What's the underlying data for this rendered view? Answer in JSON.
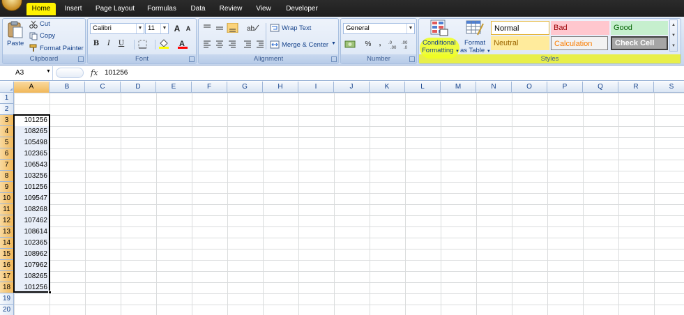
{
  "menu": {
    "tabs": [
      "Home",
      "Insert",
      "Page Layout",
      "Formulas",
      "Data",
      "Review",
      "View",
      "Developer"
    ],
    "active": "Home",
    "highlight_color": "#fff200"
  },
  "ribbon": {
    "clipboard": {
      "label": "Clipboard",
      "paste": "Paste",
      "cut": "Cut",
      "copy": "Copy",
      "format_painter": "Format Painter"
    },
    "font": {
      "label": "Font",
      "font_name": "Calibri",
      "font_size": "11",
      "bold": "B",
      "italic": "I",
      "underline": "U",
      "grow": "A",
      "shrink": "A"
    },
    "alignment": {
      "label": "Alignment",
      "wrap_text": "Wrap Text",
      "merge_center": "Merge & Center"
    },
    "number": {
      "label": "Number",
      "format": "General",
      "percent": "%",
      "comma": ","
    },
    "styles": {
      "label": "Styles",
      "conditional_formatting_1": "Conditional",
      "conditional_formatting_2": "Formatting",
      "format_as_table_1": "Format",
      "format_as_table_2": "as Table",
      "normal": "Normal",
      "bad": "Bad",
      "good": "Good",
      "neutral": "Neutral",
      "calculation": "Calculation",
      "check_cell": "Check Cell"
    }
  },
  "formula_bar": {
    "name_box": "A3",
    "fx": "fx",
    "value": "101256"
  },
  "sheet": {
    "columns": [
      "A",
      "B",
      "C",
      "D",
      "E",
      "F",
      "G",
      "H",
      "I",
      "J",
      "K",
      "L",
      "M",
      "N",
      "O",
      "P",
      "Q",
      "R",
      "S"
    ],
    "rows": [
      "1",
      "2",
      "3",
      "4",
      "5",
      "6",
      "7",
      "8",
      "9",
      "10",
      "11",
      "12",
      "13",
      "14",
      "15",
      "16",
      "17",
      "18",
      "19",
      "20"
    ],
    "column_a_values": [
      "",
      "",
      "101256",
      "108265",
      "105498",
      "102365",
      "106543",
      "103256",
      "101256",
      "109547",
      "108268",
      "107462",
      "108614",
      "102365",
      "108962",
      "107962",
      "108265",
      "101256",
      "",
      ""
    ]
  }
}
